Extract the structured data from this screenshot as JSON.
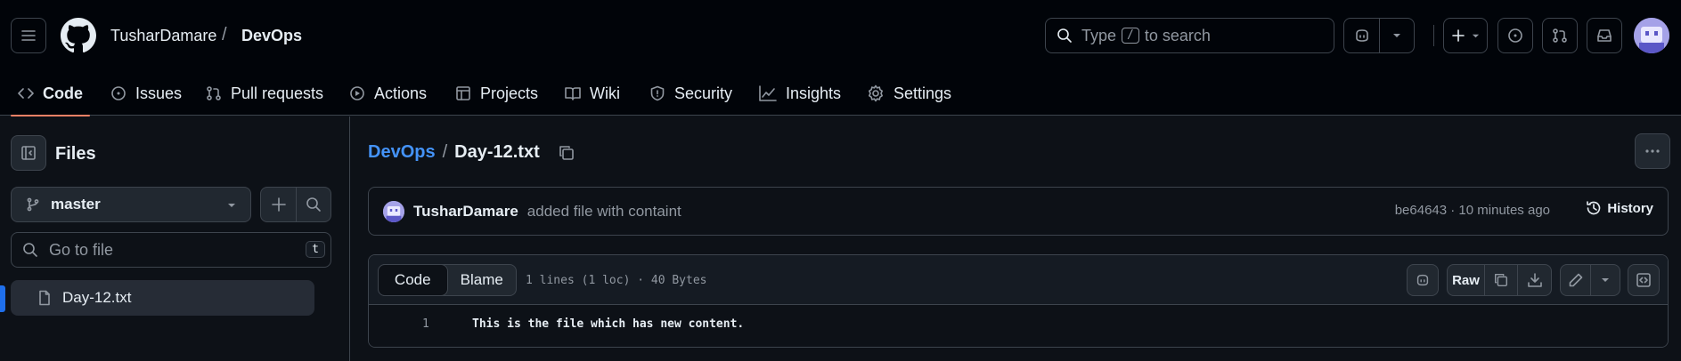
{
  "header": {
    "owner": "TusharDamare",
    "separator": "/",
    "repo": "DevOps",
    "search": {
      "prefix": "Type",
      "key": "/",
      "suffix": "to search"
    }
  },
  "tabs": [
    {
      "label": "Code",
      "icon": "code-icon"
    },
    {
      "label": "Issues",
      "icon": "issue-icon"
    },
    {
      "label": "Pull requests",
      "icon": "pull-request-icon"
    },
    {
      "label": "Actions",
      "icon": "play-icon"
    },
    {
      "label": "Projects",
      "icon": "table-icon"
    },
    {
      "label": "Wiki",
      "icon": "book-icon"
    },
    {
      "label": "Security",
      "icon": "shield-icon"
    },
    {
      "label": "Insights",
      "icon": "graph-icon"
    },
    {
      "label": "Settings",
      "icon": "gear-icon"
    }
  ],
  "sidebar": {
    "title": "Files",
    "branch": "master",
    "goto_placeholder": "Go to file",
    "goto_key": "t",
    "files": [
      {
        "name": "Day-12.txt",
        "selected": true
      }
    ]
  },
  "breadcrumb": {
    "repo": "DevOps",
    "separator": "/",
    "file": "Day-12.txt"
  },
  "commit": {
    "author": "TusharDamare",
    "message": "added file with containt",
    "meta": "be64643 · 10 minutes ago",
    "history_label": "History"
  },
  "viewer": {
    "mode_code": "Code",
    "mode_blame": "Blame",
    "info": "1 lines (1 loc) · 40 Bytes",
    "raw_label": "Raw",
    "lines": [
      {
        "number": "1",
        "text": "This is the file which has new content."
      }
    ]
  },
  "colors": {
    "background": "#0d1117",
    "accent": "#4493f8",
    "active_tab": "#f78166"
  }
}
